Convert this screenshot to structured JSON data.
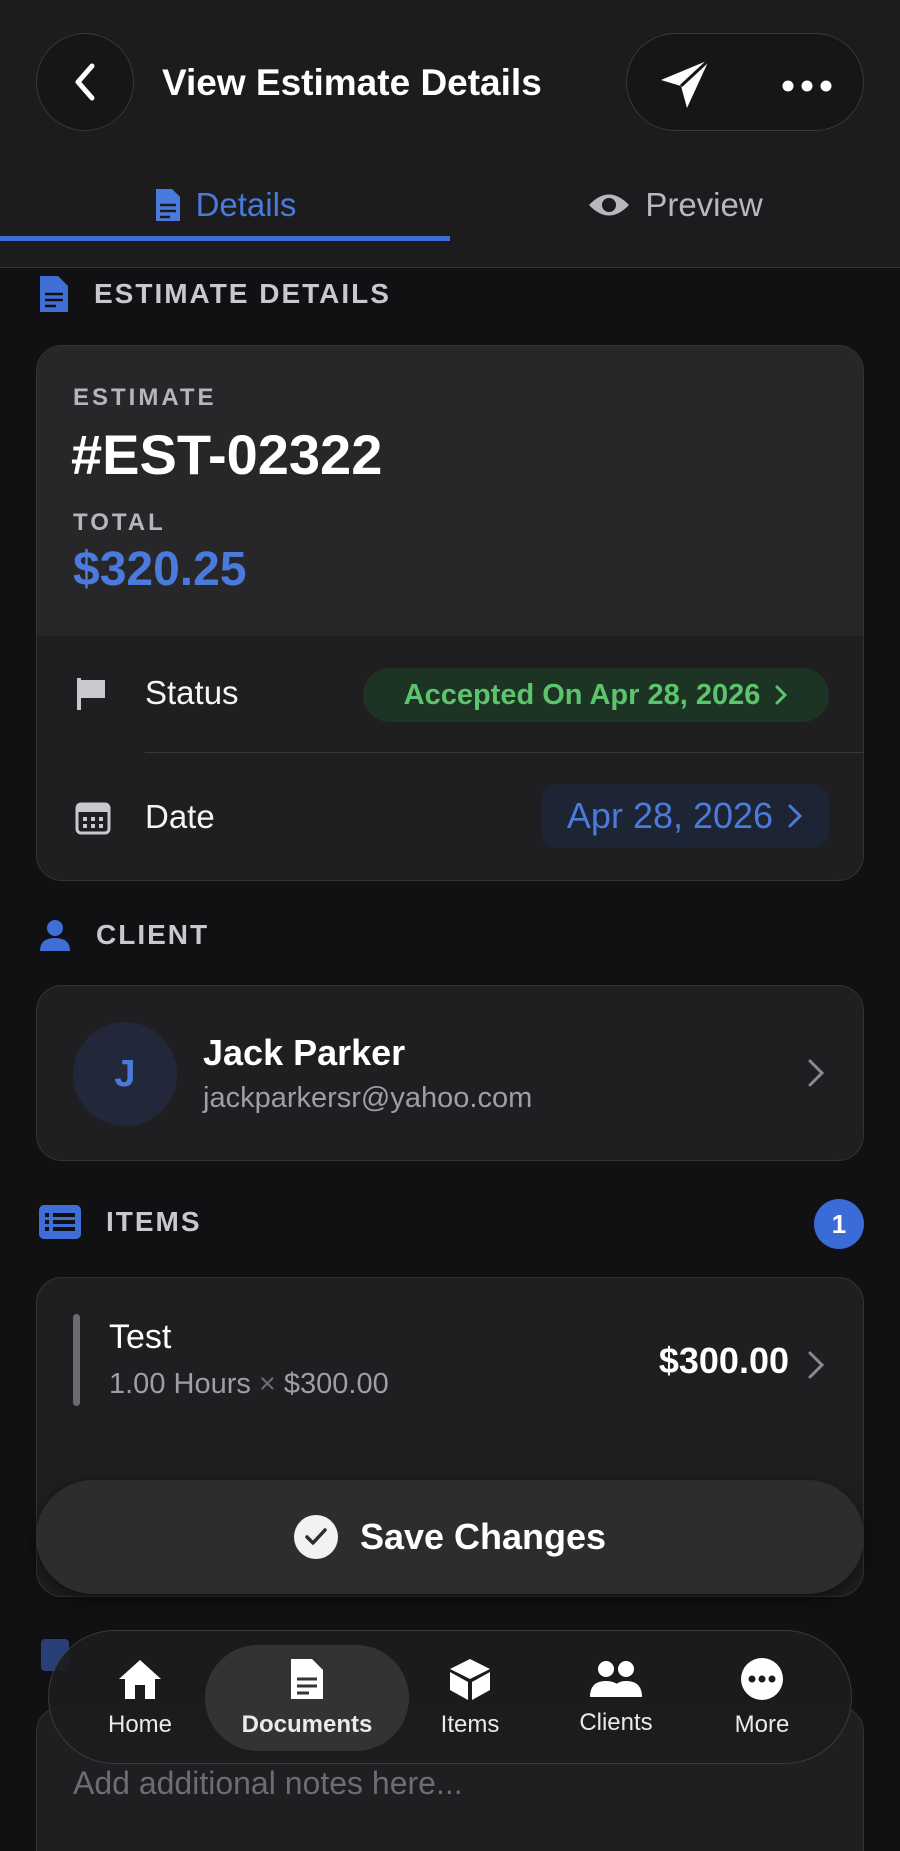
{
  "header": {
    "title": "View Estimate Details"
  },
  "tabs": {
    "details": "Details",
    "preview": "Preview"
  },
  "sections": {
    "estimate_details": "ESTIMATE DETAILS",
    "client": "CLIENT",
    "items": "ITEMS"
  },
  "estimate": {
    "label": "ESTIMATE",
    "number": "#EST-02322",
    "total_label": "TOTAL",
    "total": "$320.25",
    "status_label": "Status",
    "status_value": "Accepted On Apr 28, 2026",
    "date_label": "Date",
    "date_value": "Apr 28, 2026"
  },
  "client": {
    "initial": "J",
    "name": "Jack Parker",
    "email": "jackparkersr@yahoo.com"
  },
  "items": {
    "count": "1",
    "list": [
      {
        "name": "Test",
        "qty": "1.00 Hours",
        "times": "×",
        "rate": "$300.00",
        "total": "$300.00"
      }
    ]
  },
  "actions": {
    "save": "Save Changes"
  },
  "notes": {
    "placeholder": "Add additional notes here..."
  },
  "nav": {
    "home": "Home",
    "documents": "Documents",
    "items": "Items",
    "clients": "Clients",
    "more": "More"
  },
  "colors": {
    "accent": "#3f6fd6",
    "success": "#5cc46c",
    "background": "#111113"
  }
}
